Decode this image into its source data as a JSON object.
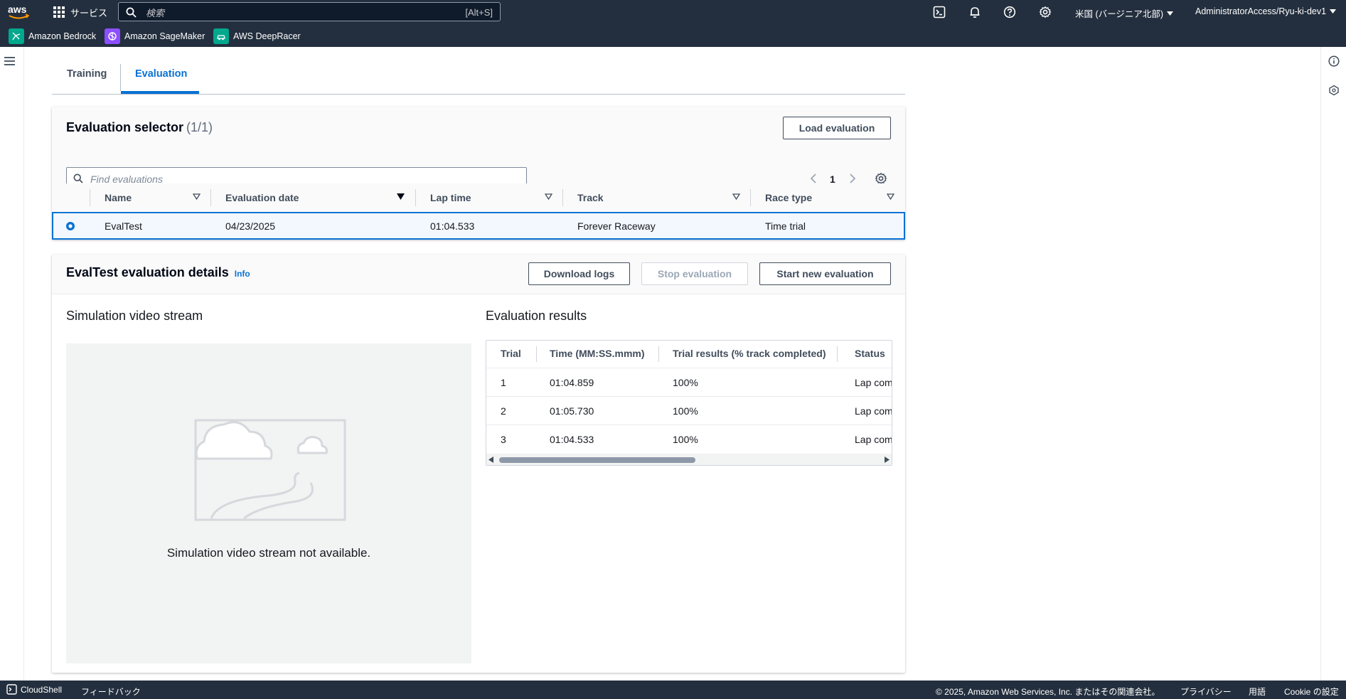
{
  "nav": {
    "services_label": "サービス",
    "search_placeholder": "検索",
    "search_shortcut": "[Alt+S]",
    "region": "米国 (バージニア北部)",
    "account": "AdministratorAccess/Ryu-ki-dev1"
  },
  "favorites": [
    {
      "label": "Amazon Bedrock",
      "icon": "bedrock-icon",
      "color": "#01a88d"
    },
    {
      "label": "Amazon SageMaker",
      "icon": "sagemaker-icon",
      "color": "#8c4fff"
    },
    {
      "label": "AWS DeepRacer",
      "icon": "deepracer-icon",
      "color": "#01a88d"
    }
  ],
  "tabs": [
    {
      "label": "Training",
      "active": false
    },
    {
      "label": "Evaluation",
      "active": true
    }
  ],
  "selector": {
    "title": "Evaluation selector",
    "count": "(1/1)",
    "load_button": "Load evaluation",
    "filter_placeholder": "Find evaluations",
    "page": "1",
    "columns": [
      "Name",
      "Evaluation date",
      "Lap time",
      "Track",
      "Race type"
    ],
    "rows": [
      {
        "name": "EvalTest",
        "date": "04/23/2025",
        "lap_time": "01:04.533",
        "track": "Forever Raceway",
        "race_type": "Time trial",
        "selected": true
      }
    ]
  },
  "details": {
    "title": "EvalTest evaluation details",
    "info_link": "Info",
    "download_logs": "Download logs",
    "stop_evaluation": "Stop evaluation",
    "start_new": "Start new evaluation",
    "video_title": "Simulation video stream",
    "video_message": "Simulation video stream not available.",
    "results_title": "Evaluation results",
    "results_columns": [
      "Trial",
      "Time (MM:SS.mmm)",
      "Trial results (% track completed)",
      "Status"
    ],
    "results_rows": [
      {
        "trial": "1",
        "time": "01:04.859",
        "result": "100%",
        "status": "Lap com"
      },
      {
        "trial": "2",
        "time": "01:05.730",
        "result": "100%",
        "status": "Lap com"
      },
      {
        "trial": "3",
        "time": "01:04.533",
        "result": "100%",
        "status": "Lap com"
      }
    ]
  },
  "footer": {
    "cloudshell": "CloudShell",
    "feedback": "フィードバック",
    "copyright": "© 2025, Amazon Web Services, Inc. またはその関連会社。",
    "privacy": "プライバシー",
    "terms": "用語",
    "cookie": "Cookie の設定"
  },
  "colors": {
    "nav_bg": "#232f3e",
    "accent": "#0972d3"
  }
}
